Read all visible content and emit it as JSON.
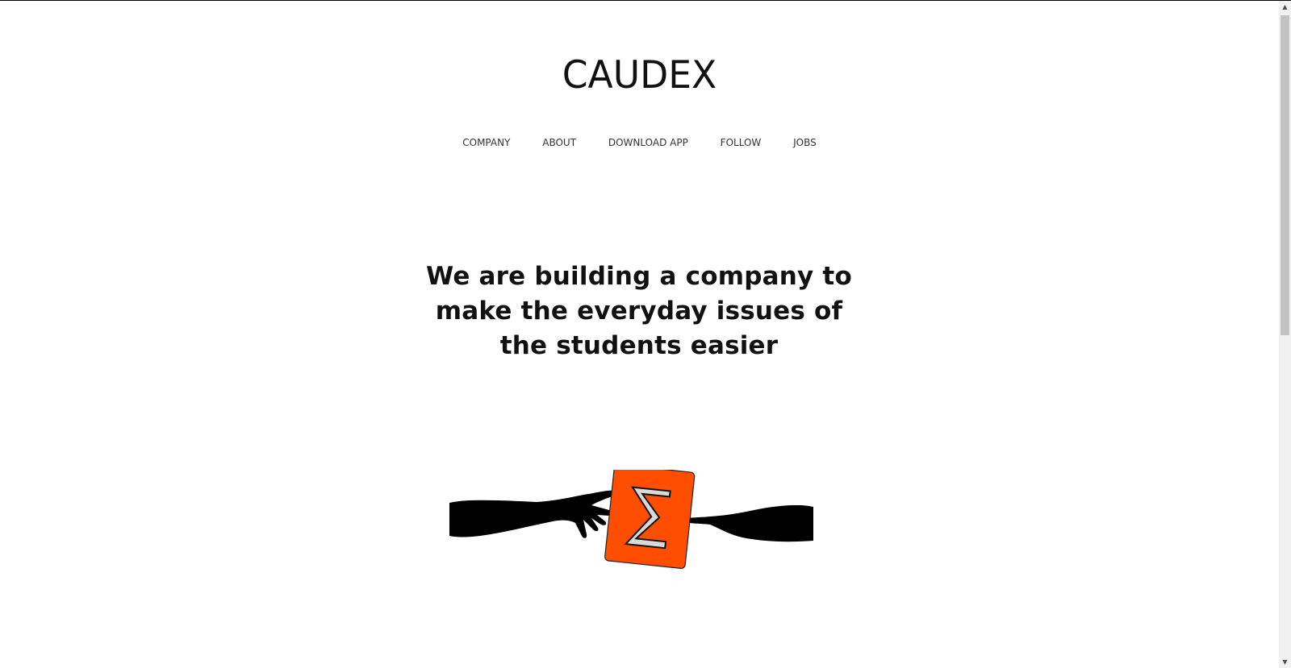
{
  "header": {
    "logo_text": "CAUDEX"
  },
  "nav": {
    "items": [
      {
        "label": "COMPANY"
      },
      {
        "label": "ABOUT"
      },
      {
        "label": "DOWNLOAD APP"
      },
      {
        "label": "FOLLOW"
      },
      {
        "label": "JOBS"
      }
    ]
  },
  "hero": {
    "headline": "We are building a company to make the everyday issues of the students easier"
  },
  "illustration": {
    "icon": "hands-with-sigma-icon",
    "accent_color": "#ff4e00",
    "ink_color": "#000000"
  },
  "scrollbar": {
    "up_icon": "▲",
    "down_icon": "▼"
  }
}
